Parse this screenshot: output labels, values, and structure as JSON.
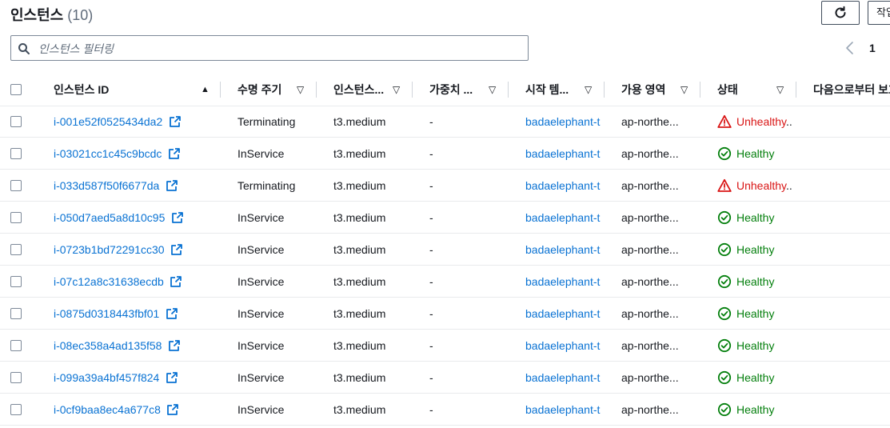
{
  "header": {
    "title": "인스턴스",
    "count": "(10)",
    "refresh_icon": "refresh-icon",
    "actions_label": "작업"
  },
  "search": {
    "placeholder": "인스턴스 필터링",
    "value": ""
  },
  "pagination": {
    "prev_icon": "chevron-left-icon",
    "current_page": "1"
  },
  "columns": [
    {
      "label": "인스턴스 ID",
      "sort": "▲"
    },
    {
      "label": "수명 주기",
      "sort": "▽"
    },
    {
      "label": "인스턴스...",
      "sort": "▽"
    },
    {
      "label": "가중치 ...",
      "sort": "▽"
    },
    {
      "label": "시작 템...",
      "sort": "▽"
    },
    {
      "label": "가용 영역",
      "sort": "▽"
    },
    {
      "label": "상태",
      "sort": "▽"
    },
    {
      "label": "다음으로부터 보호"
    }
  ],
  "rows": [
    {
      "id": "i-001e52f0525434da2",
      "lifecycle": "Terminating",
      "type": "t3.medium",
      "weight": "-",
      "template": "badaelephant-t",
      "az": "ap-northe...",
      "health": "Unhealthy",
      "health_suffix": "..",
      "healthy": false
    },
    {
      "id": "i-03021cc1c45c9bcdc",
      "lifecycle": "InService",
      "type": "t3.medium",
      "weight": "-",
      "template": "badaelephant-t",
      "az": "ap-northe...",
      "health": "Healthy",
      "health_suffix": "",
      "healthy": true
    },
    {
      "id": "i-033d587f50f6677da",
      "lifecycle": "Terminating",
      "type": "t3.medium",
      "weight": "-",
      "template": "badaelephant-t",
      "az": "ap-northe...",
      "health": "Unhealthy",
      "health_suffix": "..",
      "healthy": false
    },
    {
      "id": "i-050d7aed5a8d10c95",
      "lifecycle": "InService",
      "type": "t3.medium",
      "weight": "-",
      "template": "badaelephant-t",
      "az": "ap-northe...",
      "health": "Healthy",
      "health_suffix": "",
      "healthy": true
    },
    {
      "id": "i-0723b1bd72291cc30",
      "lifecycle": "InService",
      "type": "t3.medium",
      "weight": "-",
      "template": "badaelephant-t",
      "az": "ap-northe...",
      "health": "Healthy",
      "health_suffix": "",
      "healthy": true
    },
    {
      "id": "i-07c12a8c31638ecdb",
      "lifecycle": "InService",
      "type": "t3.medium",
      "weight": "-",
      "template": "badaelephant-t",
      "az": "ap-northe...",
      "health": "Healthy",
      "health_suffix": "",
      "healthy": true
    },
    {
      "id": "i-0875d0318443fbf01",
      "lifecycle": "InService",
      "type": "t3.medium",
      "weight": "-",
      "template": "badaelephant-t",
      "az": "ap-northe...",
      "health": "Healthy",
      "health_suffix": "",
      "healthy": true
    },
    {
      "id": "i-08ec358a4ad135f58",
      "lifecycle": "InService",
      "type": "t3.medium",
      "weight": "-",
      "template": "badaelephant-t",
      "az": "ap-northe...",
      "health": "Healthy",
      "health_suffix": "",
      "healthy": true
    },
    {
      "id": "i-099a39a4bf457f824",
      "lifecycle": "InService",
      "type": "t3.medium",
      "weight": "-",
      "template": "badaelephant-t",
      "az": "ap-northe...",
      "health": "Healthy",
      "health_suffix": "",
      "healthy": true
    },
    {
      "id": "i-0cf9baa8ec4a677c8",
      "lifecycle": "InService",
      "type": "t3.medium",
      "weight": "-",
      "template": "badaelephant-t",
      "az": "ap-northe...",
      "health": "Healthy",
      "health_suffix": "",
      "healthy": true
    }
  ],
  "colors": {
    "link": "#0972d3",
    "healthy": "#037f0c",
    "unhealthy": "#d91515",
    "text": "#16191f"
  }
}
